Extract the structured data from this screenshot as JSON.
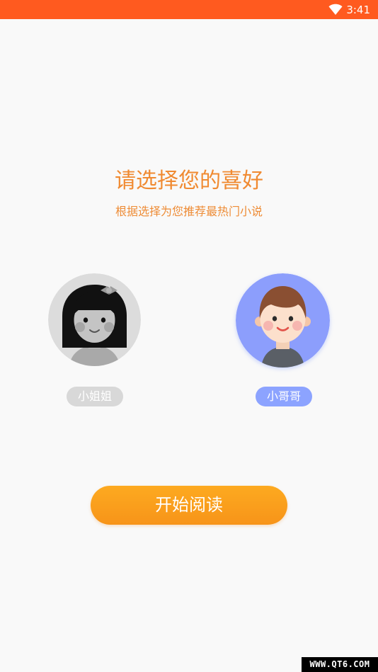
{
  "status_bar": {
    "time": "3:41",
    "background": "#ff5a1f",
    "icons": [
      "wifi-icon"
    ]
  },
  "header": {
    "title": "请选择您的喜好",
    "subtitle": "根据选择为您推荐最热门小说",
    "color": "#f08a31"
  },
  "options": [
    {
      "label": "小姐姐",
      "avatar": "girl-avatar",
      "selected": false,
      "pill_color": "#d8d8d8"
    },
    {
      "label": "小哥哥",
      "avatar": "boy-avatar",
      "selected": true,
      "pill_color": "#8ca3ff"
    }
  ],
  "start_button": {
    "label": "开始阅读",
    "color": "#f9a01c"
  },
  "watermark": {
    "text": "WWW.QT6.COM"
  }
}
